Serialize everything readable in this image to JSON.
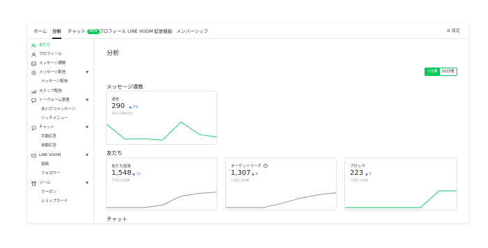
{
  "topnav": {
    "tabs": [
      {
        "label": "ホーム"
      },
      {
        "label": "分析"
      },
      {
        "label": "チャット",
        "badge": "NEW"
      },
      {
        "label": "プロフィール"
      },
      {
        "label": "LINE VOOM"
      },
      {
        "label": "拡張機能"
      },
      {
        "label": "メンバーシップ"
      }
    ],
    "active_tab": "分析",
    "settings_label": "設定",
    "settings_icon": "gear-icon"
  },
  "sidebar": {
    "items": [
      {
        "label": "友だち",
        "icon": "person-add-icon",
        "active": true
      },
      {
        "label": "プロフィール",
        "icon": "profile-icon"
      },
      {
        "label": "メッセージ通数",
        "icon": "message-count-icon"
      },
      {
        "label": "メッセージ配信",
        "icon": "broadcast-icon",
        "expandable": true
      },
      {
        "label": "メッセージ配信",
        "sub": true
      },
      {
        "label": "ステップ配信",
        "icon": "step-chart-icon"
      },
      {
        "label": "トークルーム管理",
        "icon": "chat-room-icon",
        "expandable": true
      },
      {
        "label": "あいさつメッセージ",
        "sub": true
      },
      {
        "label": "リッチメニュー",
        "sub": true
      },
      {
        "label": "チャット",
        "icon": "chat-icon",
        "expandable": true
      },
      {
        "label": "手動応答",
        "sub": true
      },
      {
        "label": "自動応答",
        "sub": true
      },
      {
        "label": "LINE VOOM",
        "icon": "voom-icon",
        "expandable": true
      },
      {
        "label": "投稿",
        "sub": true
      },
      {
        "label": "フォロワー",
        "sub": true
      },
      {
        "label": "ツール",
        "icon": "tool-icon",
        "expandable": true
      },
      {
        "label": "クーポン",
        "sub": true
      },
      {
        "label": "ショップカード",
        "sub": true
      }
    ]
  },
  "main": {
    "title": "分析",
    "period": {
      "options": [
        "7日間",
        "30日間"
      ],
      "selected": "7日間"
    },
    "sections": {
      "message_count": {
        "title": "メッセージ通数",
        "card": {
          "label": "送信",
          "value": "290",
          "delta": "▲ 2%",
          "sub": "過去7日間の合計",
          "trend": [
            0.75,
            0.12,
            0.14,
            0.08,
            0.85,
            0.32,
            0.2
          ]
        }
      },
      "friends": {
        "title": "友だち",
        "cards": [
          {
            "label": "友だち追加",
            "value": "1,548",
            "delta": "▲ 12",
            "sub": "7日前との比較",
            "trend": [
              0.0,
              0.0,
              0.0,
              0.12,
              0.55,
              0.68,
              0.75
            ]
          },
          {
            "label": "ターゲットリーチ",
            "help_icon": "help-circle-icon",
            "value": "1,307",
            "delta": "▲ 9",
            "sub": "7日前との比較",
            "trend": [
              0.0,
              0.0,
              0.0,
              0.2,
              0.45,
              0.62,
              0.72
            ]
          },
          {
            "label": "ブロック",
            "value": "223",
            "delta": "▲ 3",
            "sub": "7日前との比較",
            "trend": [
              0.0,
              0.0,
              0.0,
              0.0,
              0.0,
              0.8,
              0.8
            ]
          }
        ]
      },
      "chat": {
        "title": "チャット"
      }
    }
  },
  "colors": {
    "accent": "#06c755",
    "delta": "#3a7bd5",
    "line_gray": "#8a8a8a"
  }
}
